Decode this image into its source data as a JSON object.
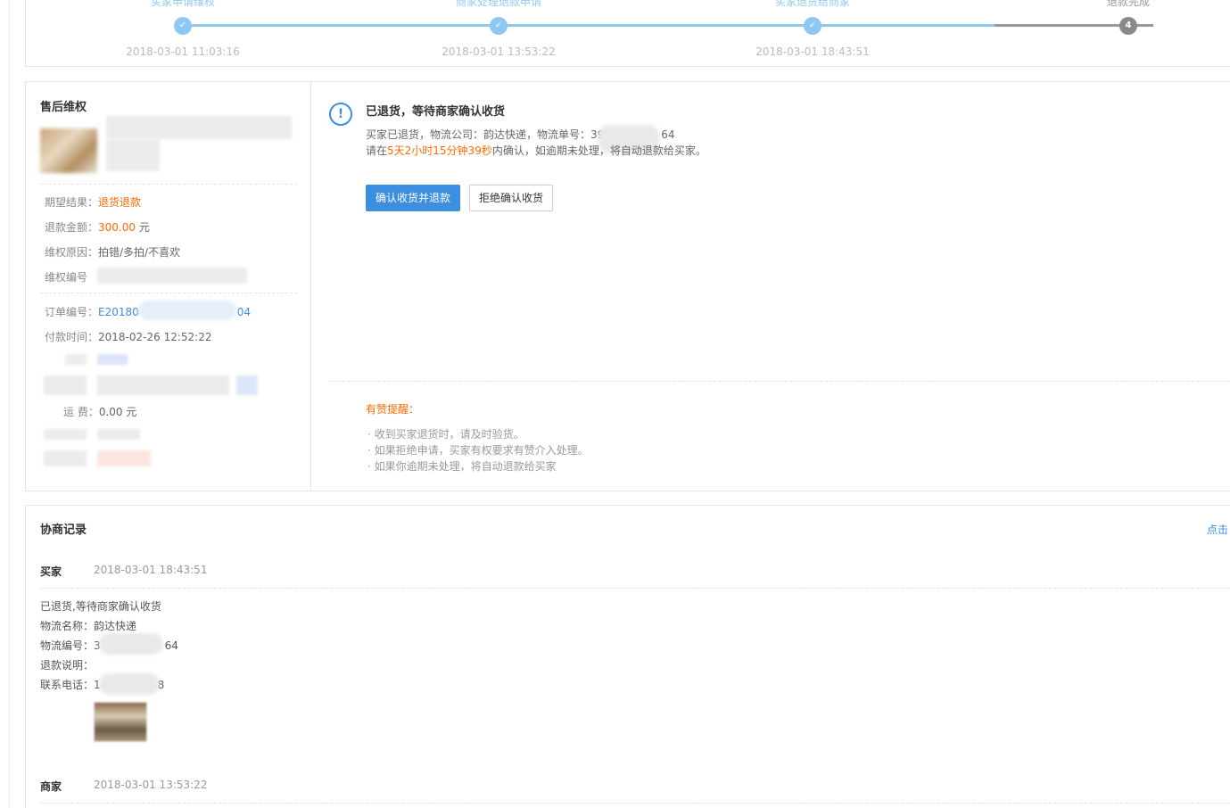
{
  "progress": {
    "steps": [
      {
        "label": "买家申请维权",
        "time": "2018-03-01 11:03:16",
        "icon": "check-icon"
      },
      {
        "label": "商家处理退款申请",
        "time": "2018-03-01 13:53:22",
        "icon": "check-icon"
      },
      {
        "label": "买家退货给商家",
        "time": "2018-03-01 18:43:51",
        "icon": "check-icon"
      },
      {
        "label": "退款完成",
        "number": "4"
      }
    ],
    "colors": {
      "done": "#8ec8f2",
      "pending": "#8a8a8a"
    }
  },
  "aftersale": {
    "title": "售后维权",
    "expect_label": "期望结果：",
    "expect_value": "退货退款",
    "amount_label": "退款金额：",
    "amount_value": "300.00",
    "amount_unit": " 元",
    "reason_label": "维权原因：",
    "reason_value": "拍错/多拍/不喜欢",
    "case_no_label": "维权编号",
    "order_no_label": "订单编号：",
    "order_no_prefix": "E20180",
    "order_no_suffix": "04",
    "pay_time_label": "付款时间：",
    "pay_time_value": "2018-02-26 12:52:22",
    "shipping_label": "运 费：",
    "shipping_value": "0.00 元"
  },
  "status": {
    "title": "已退货，等待商家确认收货",
    "line1_prefix": "买家已退货，物流公司：韵达快递，物流单号：39",
    "line1_suffix": "64",
    "line2_prefix": "请在",
    "line2_countdown": "5天2小时15分钟39秒",
    "line2_suffix": "内确认，如逾期未处理，将自动退款给买家。",
    "confirm_button": "确认收货并退款",
    "reject_button": "拒绝确认收货",
    "tips_title": "有赞提醒：",
    "tips": [
      "· 收到买家退货时，请及时验货。",
      "· 如果拒绝申请，买家有权要求有赞介入处理。",
      "· 如果你逾期未处理，将自动退款给买家"
    ],
    "accent_color": "#3b8ee0",
    "warn_color": "#ff6a00"
  },
  "records": {
    "title": "协商记录",
    "link": "点击",
    "entries": [
      {
        "role": "买家",
        "time": "2018-03-01 18:43:51",
        "desc": "已退货,等待商家确认收货",
        "logistics_name_label": "物流名称：",
        "logistics_name_value": "韵达快递",
        "logistics_no_label": "物流编号：",
        "logistics_no_prefix": "3",
        "logistics_no_suffix": "64",
        "refund_note_label": "退款说明：",
        "phone_label": "联系电话：",
        "phone_prefix": "1",
        "phone_suffix": "8"
      },
      {
        "role": "商家",
        "time": "2018-03-01 13:53:22"
      }
    ]
  }
}
